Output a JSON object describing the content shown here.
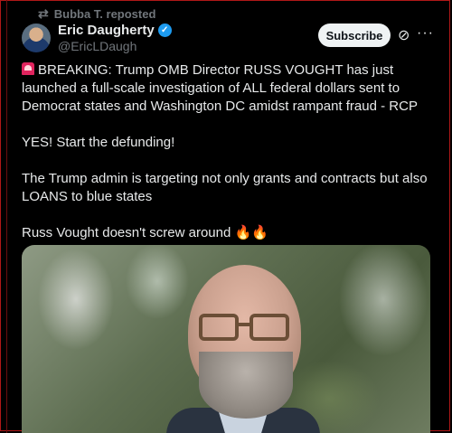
{
  "repost": {
    "icon": "repost-icon",
    "label": "Bubba T. reposted"
  },
  "author": {
    "name": "Eric Daugherty",
    "handle": "@EricLDaugh",
    "verified": true
  },
  "actions": {
    "subscribe_label": "Subscribe",
    "grok_icon": "grok-icon",
    "more_icon": "more-icon"
  },
  "post": {
    "line1": "BREAKING: Trump OMB Director RUSS VOUGHT has just launched a full-scale investigation of ALL federal dollars sent to Democrat states and Washington DC amidst rampant fraud - RCP",
    "line2": "YES! Start the defunding!",
    "line3": "The Trump admin is targeting not only grants and contracts but also LOANS to blue states",
    "line4": "Russ Vought doesn't screw around",
    "fire_emoji": "🔥🔥"
  },
  "media": {
    "icon": "photo-man-glasses"
  },
  "colors": {
    "background": "#000000",
    "text": "#e7e9ea",
    "muted": "#71767b",
    "accent": "#1d9bf0",
    "border": "#b01818"
  }
}
